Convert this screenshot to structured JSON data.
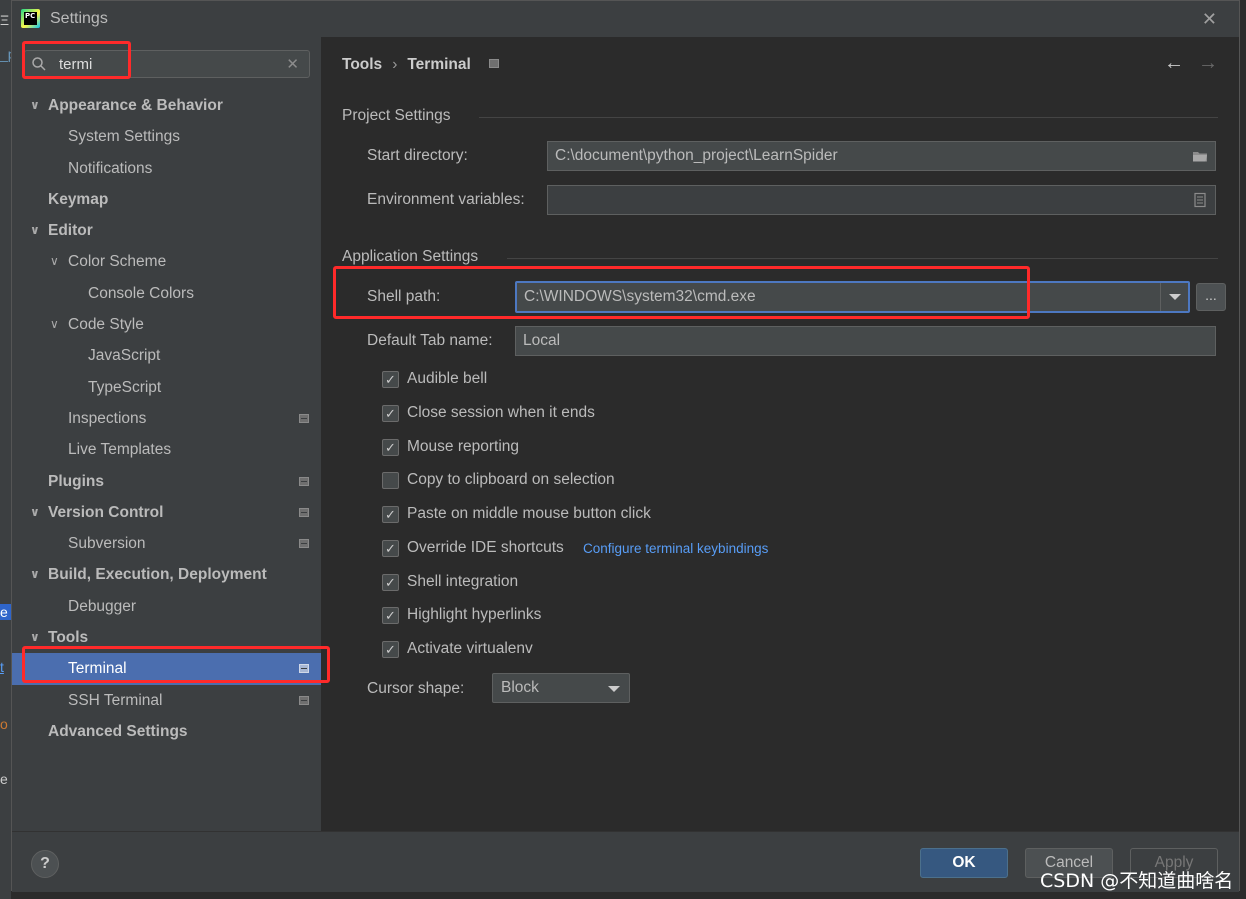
{
  "window": {
    "title": "Settings",
    "close_glyph": "✕"
  },
  "ide_fragments": [
    "Ξ",
    "_p",
    "e",
    "t",
    "o",
    "e"
  ],
  "search": {
    "value": "termi",
    "clear_glyph": "✕"
  },
  "sidebar": {
    "items": [
      {
        "label": "Appearance & Behavior",
        "chevron": "expanded",
        "bold": true
      },
      {
        "label": "System Settings"
      },
      {
        "label": "Notifications"
      },
      {
        "label": "Keymap",
        "bold": true
      },
      {
        "label": "Editor",
        "chevron": "expanded",
        "bold": true
      },
      {
        "label": "Color Scheme",
        "chevron": "expanded"
      },
      {
        "label": "Console Colors"
      },
      {
        "label": "Code Style",
        "chevron": "expanded"
      },
      {
        "label": "JavaScript"
      },
      {
        "label": "TypeScript"
      },
      {
        "label": "Inspections",
        "badge": true
      },
      {
        "label": "Live Templates"
      },
      {
        "label": "Plugins",
        "bold": true,
        "badge": true
      },
      {
        "label": "Version Control",
        "chevron": "expanded",
        "bold": true,
        "badge": true
      },
      {
        "label": "Subversion",
        "badge": true
      },
      {
        "label": "Build, Execution, Deployment",
        "chevron": "expanded",
        "bold": true
      },
      {
        "label": "Debugger"
      },
      {
        "label": "Tools",
        "chevron": "expanded",
        "bold": true
      },
      {
        "label": "Terminal",
        "badge": true,
        "selected": true
      },
      {
        "label": "SSH Terminal",
        "badge": true
      },
      {
        "label": "Advanced Settings",
        "bold": true
      }
    ]
  },
  "breadcrumb": {
    "parent": "Tools",
    "separator": "›",
    "current": "Terminal"
  },
  "nav": {
    "back_glyph": "←",
    "forward_glyph": "→"
  },
  "project_settings": {
    "title": "Project Settings",
    "start_directory": {
      "label": "Start directory:",
      "value": "C:\\document\\python_project\\LearnSpider"
    },
    "environment_variables": {
      "label": "Environment variables:",
      "value": ""
    }
  },
  "application_settings": {
    "title": "Application Settings",
    "shell_path": {
      "label": "Shell path:",
      "value": "C:\\WINDOWS\\system32\\cmd.exe"
    },
    "browse_label": "...",
    "default_tab_name": {
      "label": "Default Tab name:",
      "value": "Local"
    },
    "checkboxes": [
      {
        "label": "Audible bell",
        "checked": true,
        "mark": "✓"
      },
      {
        "label": "Close session when it ends",
        "checked": true,
        "mark": "✓"
      },
      {
        "label": "Mouse reporting",
        "checked": true,
        "mark": "✓"
      },
      {
        "label": "Copy to clipboard on selection",
        "checked": false,
        "mark": ""
      },
      {
        "label": "Paste on middle mouse button click",
        "checked": true,
        "mark": "✓"
      },
      {
        "label": "Override IDE shortcuts",
        "checked": true,
        "mark": "✓"
      },
      {
        "label": "Shell integration",
        "checked": true,
        "mark": "✓"
      },
      {
        "label": "Highlight hyperlinks",
        "checked": true,
        "mark": "✓"
      },
      {
        "label": "Activate virtualenv",
        "checked": true,
        "mark": "✓"
      }
    ],
    "keybindings_link": "Configure terminal keybindings",
    "cursor_shape": {
      "label": "Cursor shape:",
      "value": "Block"
    }
  },
  "footer": {
    "help_label": "?",
    "ok_label": "OK",
    "cancel_label": "Cancel",
    "apply_label": "Apply"
  },
  "watermark": "CSDN @不知道曲啥名",
  "colors": {
    "accent": "#4b6eaf",
    "link": "#589df6",
    "highlight_box": "#ff2a2a",
    "ok_button": "#365880"
  }
}
